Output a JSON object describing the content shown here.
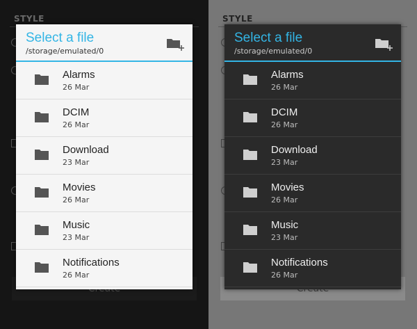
{
  "background": {
    "section_label": "STYLE",
    "create_label": "Create"
  },
  "dialog": {
    "title": "Select a file",
    "path": "/storage/emulated/0",
    "new_folder_icon": "folder-add-icon",
    "accent_color": "#33b5e5"
  },
  "files": [
    {
      "name": "Alarms",
      "date": "26 Mar"
    },
    {
      "name": "DCIM",
      "date": "26 Mar"
    },
    {
      "name": "Download",
      "date": "23 Mar"
    },
    {
      "name": "Movies",
      "date": "26 Mar"
    },
    {
      "name": "Music",
      "date": "23 Mar"
    },
    {
      "name": "Notifications",
      "date": "26 Mar"
    }
  ],
  "themes": {
    "light": {
      "dialog_bg": "#f5f5f5",
      "icon_color": "#555555"
    },
    "dark": {
      "dialog_bg": "#2a2a2a",
      "icon_color": "#cfcfcf"
    }
  }
}
